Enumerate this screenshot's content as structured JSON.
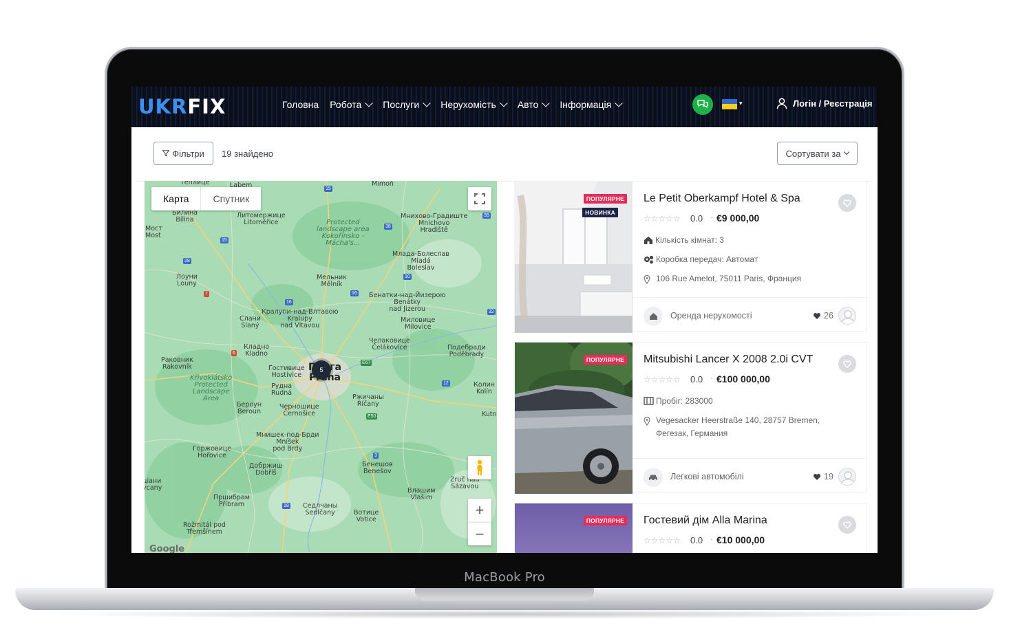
{
  "device": {
    "label": "MacBook Pro"
  },
  "header": {
    "logo_part1": "UKR",
    "logo_part2": "FIX",
    "nav": [
      {
        "label": "Головна",
        "has_dropdown": false
      },
      {
        "label": "Робота",
        "has_dropdown": true
      },
      {
        "label": "Послуги",
        "has_dropdown": true
      },
      {
        "label": "Нерухомість",
        "has_dropdown": true
      },
      {
        "label": "Авто",
        "has_dropdown": true
      },
      {
        "label": "Інформація",
        "has_dropdown": true
      }
    ],
    "chat_icon": "chat-bubbles-icon",
    "language_flag": "ukraine-flag",
    "language_caret": "▾",
    "login_label": "Логін / Реєстрація",
    "colors": {
      "header_bg": "#0a0f1a",
      "logo_accent": "#3d8ff2",
      "chat_green": "#1db249"
    }
  },
  "toolbar": {
    "filters_label": "Фільтри",
    "found_text": "19 знайдено",
    "sort_label": "Сортувати за"
  },
  "map": {
    "type_map": "Карта",
    "type_satellite": "Спутник",
    "cluster_count": "5",
    "zoom_in": "+",
    "zoom_out": "−",
    "google_logo": "Google",
    "places": {
      "teplice": "Теплице",
      "lahem": "Labem",
      "mimon": "Mimoň",
      "bilina": "Билина\nBílina",
      "litomerice": "Литомержице\nLitoměřice",
      "protected1": "Protected\nlandscape area\nKokořínsko -\nMácha's...",
      "mnichovo": "Мнихово-Градиште\nMnichovo\nHradiště",
      "most": "Мост\nMost",
      "mlada": "Млада-Болеслав\nMladá\nBoleslav",
      "louny": "Лоуни\nLouny",
      "melnik": "Мельник\nMělník",
      "benatky": "Бенатки-над-Йизерою\nBenátky\nnad Jizerou",
      "kralupy": "Кралупи-над-Влтавою\nKralupy\nnad Vltavou",
      "slany": "Слани\nSlaný",
      "milovice": "Миловице\nMilovice",
      "celakovice": "Челаковице\nČelákovice",
      "kladno": "Кладно\nKladno",
      "podebrady": "Подебради\nPoděbrady",
      "rakovnik": "Раковник\nRakovník",
      "hostivice": "Гостивице\nHostivice",
      "praha": "Прага\nPraha",
      "krivoklatsko": "Křivoklátsko\nProtected\nLandscape\nArea",
      "rudna": "Рудна\nRudná",
      "kolin": "Колин\nKolín",
      "ricany": "Ржичаны\nŘíčany",
      "beroun": "Бероун\nBeroun",
      "cernosice": "Черношице\nČernošice",
      "kutna": "Kutn",
      "mnisek": "Мнишек-под-Брди\nMníšek\npod Brdy",
      "horovice": "Горжовице\nHořovice",
      "dobris": "Добржиш\nDobříš",
      "benesov": "Бенешов\nBenešov",
      "zruc": "Zruč nad\nSázavou",
      "vlasim": "Влашим\nVlašim",
      "pribram": "Пршибрам\nPříbram",
      "sedlcany": "Седлчаны\nSedlčany",
      "votice": "Вотице\nVotice",
      "rozmital": "Rožmitál pod\nTřemšínem",
      "jince": "ціани\nvcany"
    }
  },
  "listings": [
    {
      "title": "Le Petit Oberkampf Hotel & Spa",
      "badges": [
        "ПОПУЛЯРНЕ",
        "НОВИНКА"
      ],
      "stars": "☆☆☆☆☆",
      "rating": "0.0",
      "separator": "·",
      "price": "€9 000,00",
      "features": [
        {
          "icon": "house-icon",
          "text": "Кількість кімнат: 3"
        },
        {
          "icon": "gears-icon",
          "text": "Коробка передач: Автомат"
        }
      ],
      "address": "106 Rue Amelot, 75011 Paris, Франция",
      "category": "Оренда нерухомості",
      "category_icon": "home-icon",
      "likes": "26"
    },
    {
      "title": "Mitsubishi Lancer X 2008 2.0i CVT",
      "badges": [
        "ПОПУЛЯРНЕ"
      ],
      "stars": "☆☆☆☆☆",
      "rating": "0.0",
      "separator": "·",
      "price": "€100 000,00",
      "features": [
        {
          "icon": "odometer-icon",
          "text": "Пробіг: 283000"
        }
      ],
      "address": "Vegesacker Heerstraße 140, 28757 Bremen, Фегезак, Германия",
      "category": "Легкові автомобілі",
      "category_icon": "car-icon",
      "likes": "19"
    },
    {
      "title": "Гостевий дім Alla Marina",
      "badges": [
        "ПОПУЛЯРНЕ"
      ],
      "stars": "☆☆☆☆☆",
      "rating": "0.0",
      "separator": "·",
      "price": "€10 000,00"
    }
  ]
}
